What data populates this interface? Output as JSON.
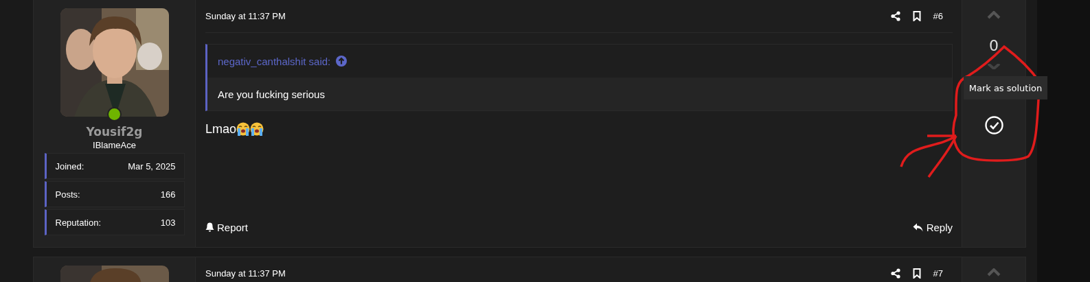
{
  "posts": [
    {
      "user": {
        "name": "Yousif2g",
        "title": "IBlameAce",
        "online": true,
        "stats": [
          {
            "label": "Joined:",
            "value": "Mar 5, 2025"
          },
          {
            "label": "Posts:",
            "value": "166"
          },
          {
            "label": "Reputation:",
            "value": "103"
          }
        ]
      },
      "date": "Sunday at 11:37 PM",
      "number": "#6",
      "quote": {
        "author": "negativ_canthalshit said:",
        "text": "Are you fucking serious"
      },
      "body": "Lmao",
      "actions": {
        "left": "Report",
        "right": "Reply"
      },
      "score": "0",
      "tooltip": "Mark as solution"
    },
    {
      "date": "Sunday at 11:37 PM",
      "number": "#7"
    }
  ]
}
